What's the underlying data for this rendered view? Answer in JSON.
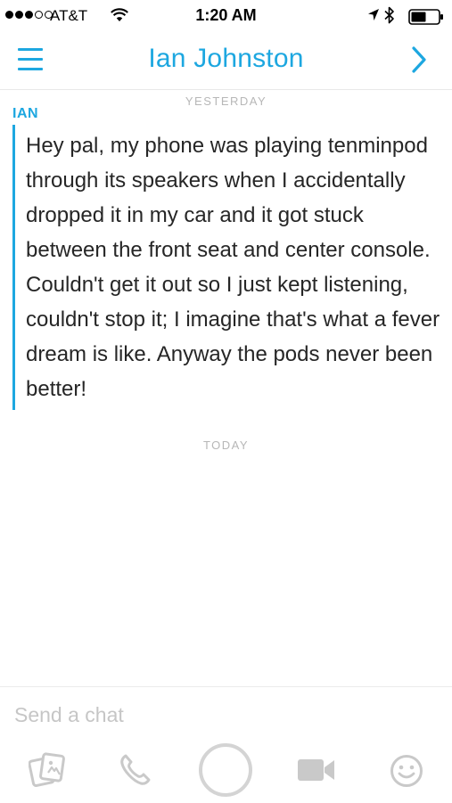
{
  "status_bar": {
    "carrier": "AT&T",
    "time": "1:20 AM",
    "signal_bars_filled": 3,
    "signal_bars_total": 5,
    "icons": [
      "wifi-icon",
      "location-icon",
      "bluetooth-icon",
      "battery-icon"
    ]
  },
  "header": {
    "title": "Ian Johnston",
    "left_icon": "menu-icon",
    "right_icon": "chevron-right-icon",
    "accent_color": "#1da7e0"
  },
  "messages": {
    "yesterday_label": "YESTERDAY",
    "sender": "IAN",
    "text": "Hey pal, my phone was playing tenminpod through its speakers when I accidentally dropped it in my car and it got stuck between the front seat and center console. Couldn't get it out so I just kept listening, couldn't stop it; I imagine that's what a fever dream is like. Anyway the pods never been better!",
    "today_label": "TODAY"
  },
  "composer": {
    "placeholder": "Send a chat",
    "value": "",
    "buttons": [
      "gallery-icon",
      "phone-icon",
      "capture-button",
      "video-icon",
      "emoji-icon"
    ]
  }
}
